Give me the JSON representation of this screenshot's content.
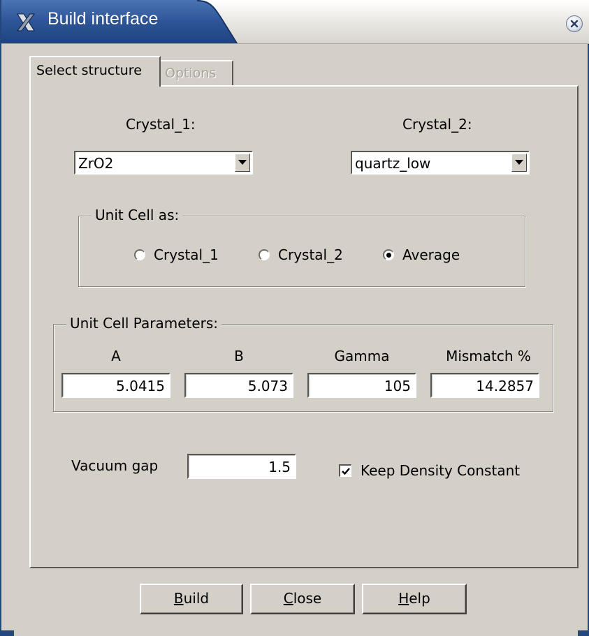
{
  "window": {
    "title": "Build interface",
    "app_icon": "x-icon",
    "close_icon": "close-icon",
    "title_color": "#24487e"
  },
  "tabs": [
    {
      "label": "Select structure",
      "active": true
    },
    {
      "label": "Options",
      "active": false
    }
  ],
  "crystals": {
    "crystal1_label": "Crystal_1:",
    "crystal1_value": "ZrO2",
    "crystal2_label": "Crystal_2:",
    "crystal2_value": "quartz_low"
  },
  "unit_cell_as": {
    "title": "Unit Cell as:",
    "options": [
      "Crystal_1",
      "Crystal_2",
      "Average"
    ],
    "selected": "Average"
  },
  "unit_cell_params": {
    "title": "Unit Cell Parameters:",
    "columns": [
      "A",
      "B",
      "Gamma",
      "Mismatch %"
    ],
    "values": [
      "5.0415",
      "5.073",
      "105",
      "14.2857"
    ]
  },
  "vacuum_gap": {
    "label": "Vacuum gap",
    "value": "1.5"
  },
  "keep_density": {
    "label": "Keep Density Constant",
    "checked": true
  },
  "buttons": {
    "build": {
      "mnemonic": "B",
      "rest": "uild"
    },
    "close": {
      "mnemonic": "C",
      "rest": "lose"
    },
    "help": {
      "mnemonic": "H",
      "rest": "elp"
    }
  }
}
